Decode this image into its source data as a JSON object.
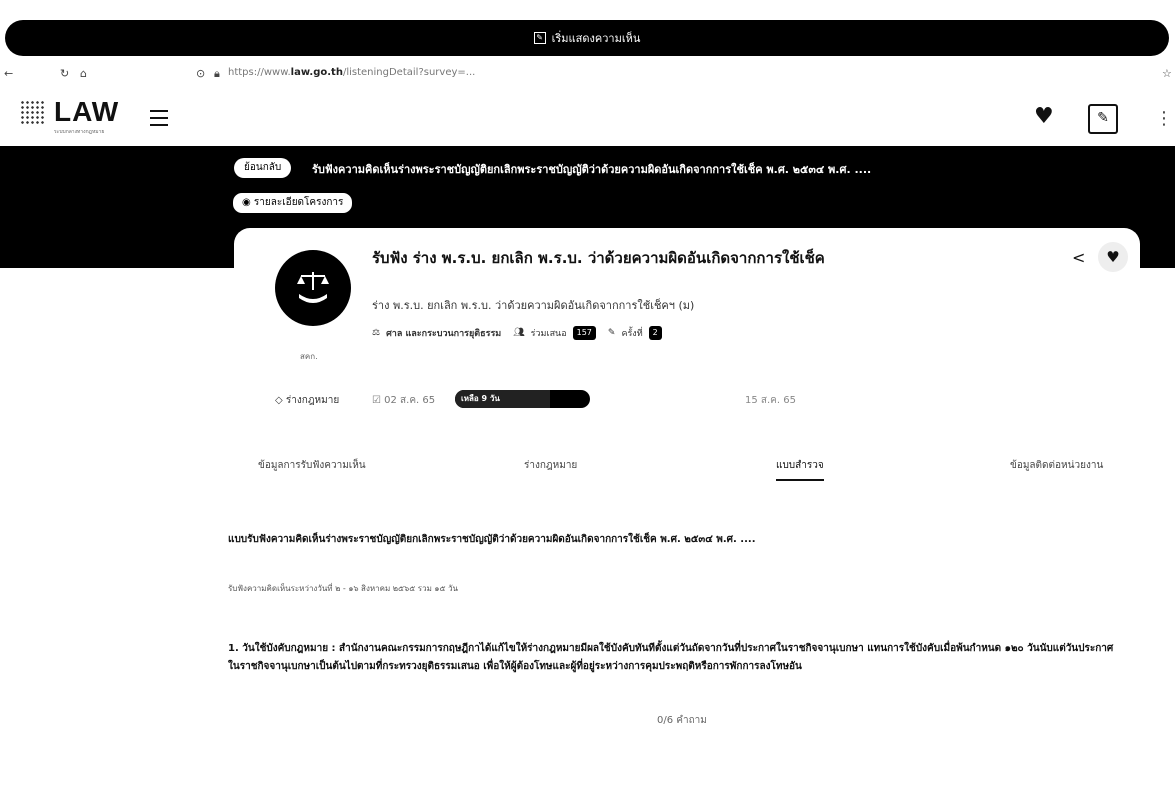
{
  "banner": {
    "text": "เริ่มแสดงความเห็น",
    "icon": "edit-icon"
  },
  "browser": {
    "back_icon": "back-arrow-icon",
    "reload_icon": "reload-icon",
    "url_domain": "law.go.th",
    "url_prefix": "https://www.",
    "url_rest": "/listeningDetail?survey=..."
  },
  "header": {
    "logo_text": "LAW",
    "logo_sub": "ระบบกลางทางกฎหมาย"
  },
  "hero": {
    "back_label": "ย้อนกลับ",
    "title": "รับฟังความคิดเห็นร่างพระราชบัญญัติยกเลิกพระราชบัญญัติว่าด้วยความผิดอันเกิดจากการใช้เช็ค พ.ศ. ๒๕๓๔ พ.ศ. ....",
    "project_label": "รายละเอียดโครงการ"
  },
  "card": {
    "title": "รับฟัง ร่าง พ.ร.บ. ยกเลิก พ.ร.บ. ว่าด้วยความผิดอันเกิดจากการใช้เช็ค",
    "subtitle": "ร่าง พ.ร.บ. ยกเลิก พ.ร.บ. ว่าด้วยความผิดอันเกิดจากการใช้เช็คฯ (ม)",
    "category": "ศาล และกระบวนการยุติธรรม",
    "participants_label": "ร่วมเสนอ",
    "participants": "157",
    "round_label": "ครั้งที่",
    "round": "2",
    "agency_caption": "สคก.",
    "type": "ร่างกฎหมาย",
    "date_start": "02 ส.ค. 65",
    "days_left_label": "เหลือ 9 วัน",
    "days_progress": 0.7,
    "date_end": "15 ส.ค. 65"
  },
  "tabs": [
    {
      "label": "ข้อมูลการรับฟังความเห็น"
    },
    {
      "label": "ร่างกฎหมาย"
    },
    {
      "label": "แบบสำรวจ"
    },
    {
      "label": "ข้อมูลติดต่อหน่วยงาน"
    }
  ],
  "survey": {
    "title": "แบบรับฟังความคิดเห็นร่างพระราชบัญญัติยกเลิกพระราชบัญญัติว่าด้วยความผิดอันเกิดจากการใช้เช็ค พ.ศ. ๒๕๓๔ พ.ศ. ....",
    "period": "รับฟังความคิดเห็นระหว่างวันที่ ๒ - ๑๖ สิงหาคม ๒๕๖๕ รวม ๑๕ วัน",
    "question": "1. วันใช้บังคับกฎหมาย : สำนักงานคณะกรรมการกฤษฎีกาได้แก้ไขให้ร่างกฎหมายมีผลใช้บังคับทันทีตั้งแต่วันถัดจากวันที่ประกาศในราชกิจจานุเบกษา แทนการใช้บังคับเมื่อพ้นกำหนด ๑๒๐ วันนับแต่วันประกาศในราชกิจจานุเบกษาเป็นต้นไปตามที่กระทรวงยุติธรรมเสนอ เพื่อให้ผู้ต้องโทษและผู้ที่อยู่ระหว่างการคุมประพฤติหรือการพักการลงโทษอัน",
    "counter": "0/6 คำถาม"
  }
}
